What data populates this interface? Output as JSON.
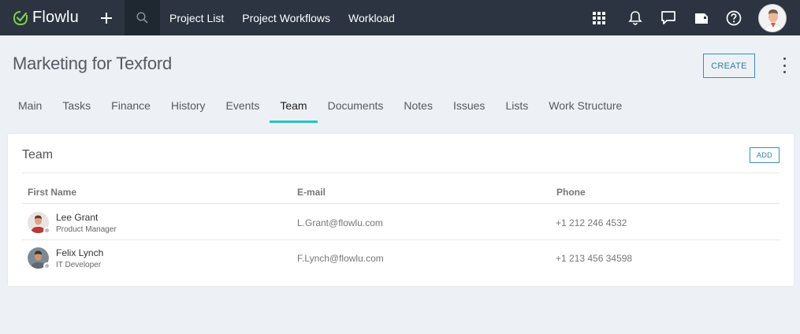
{
  "app": {
    "name": "Flowlu"
  },
  "nav": {
    "links": [
      "Project List",
      "Project Workflows",
      "Workload"
    ]
  },
  "page": {
    "title": "Marketing for Texford",
    "create_label": "CREATE"
  },
  "tabs": [
    {
      "label": "Main"
    },
    {
      "label": "Tasks"
    },
    {
      "label": "Finance"
    },
    {
      "label": "History"
    },
    {
      "label": "Events"
    },
    {
      "label": "Team",
      "active": true
    },
    {
      "label": "Documents"
    },
    {
      "label": "Notes"
    },
    {
      "label": "Issues"
    },
    {
      "label": "Lists"
    },
    {
      "label": "Work Structure"
    }
  ],
  "team": {
    "title": "Team",
    "add_label": "ADD",
    "columns": [
      "First Name",
      "E-mail",
      "Phone"
    ],
    "rows": [
      {
        "name": "Lee Grant",
        "role": "Product Manager",
        "email": "L.Grant@flowlu.com",
        "phone": "+1 212 246 4532"
      },
      {
        "name": "Felix Lynch",
        "role": "IT Developer",
        "email": "F.Lynch@flowlu.com",
        "phone": "+1 213 456 34598"
      }
    ]
  },
  "colors": {
    "topbar": "#2b3440",
    "accent": "#2cbfc9",
    "logo_green": "#7fd34a",
    "button_blue": "#2d7fa9"
  },
  "icons": [
    "logo-check-icon",
    "plus-icon",
    "search-icon",
    "apps-grid-icon",
    "bell-icon",
    "chat-icon",
    "folder-icon",
    "help-icon",
    "user-avatar",
    "kebab-menu-icon"
  ]
}
